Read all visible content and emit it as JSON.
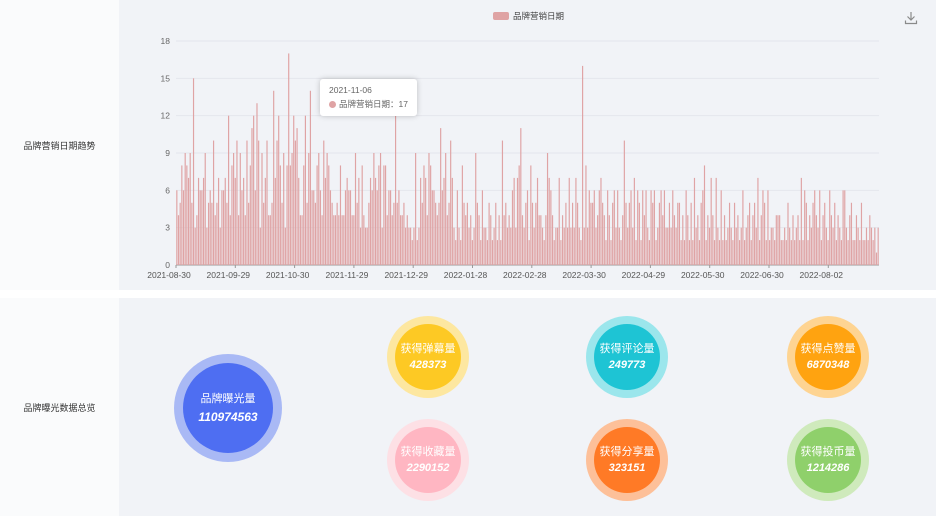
{
  "sections": {
    "trend_label": "品牌营销日期趋势",
    "summary_label": "品牌曝光数据总览"
  },
  "tooltip": {
    "date": "2021-11-06",
    "series": "品牌营销日期",
    "value_text": "17"
  },
  "toolbar": {
    "download_icon": "download-icon"
  },
  "stats": {
    "main": {
      "label": "品牌曝光量",
      "value": "110974563",
      "color": "#4e6ef2",
      "ring": "#a9b9f5"
    },
    "danmaku": {
      "label": "获得弹幕量",
      "value": "428373",
      "color": "#fdc924",
      "ring": "#fde7a0"
    },
    "comments": {
      "label": "获得评论量",
      "value": "249773",
      "color": "#1ec4d4",
      "ring": "#9be6ec"
    },
    "likes": {
      "label": "获得点赞量",
      "value": "6870348",
      "color": "#ffa310",
      "ring": "#fed492"
    },
    "favorites": {
      "label": "获得收藏量",
      "value": "2290152",
      "color": "#ffb6c2",
      "ring": "#fde0e5"
    },
    "shares": {
      "label": "获得分享量",
      "value": "323151",
      "color": "#ff7a26",
      "ring": "#fdc099"
    },
    "coins": {
      "label": "获得投币量",
      "value": "1214286",
      "color": "#8fd06b",
      "ring": "#cfeabc"
    }
  },
  "chart_data": {
    "type": "bar",
    "legend": {
      "name": "品牌营销日期",
      "position": "top-center"
    },
    "bar_color": "#dfa3a4",
    "ylim": [
      0,
      18
    ],
    "y_ticks": [
      "0",
      "3",
      "6",
      "9",
      "12",
      "15",
      "18"
    ],
    "x_tick_labels": [
      "2021-08-30",
      "2021-09-29",
      "2021-10-30",
      "2021-11-29",
      "2021-12-29",
      "2022-01-28",
      "2022-02-28",
      "2022-03-30",
      "2022-04-29",
      "2022-05-30",
      "2022-06-30",
      "2022-08-02"
    ],
    "grid": true,
    "series": [
      {
        "values": [
          6,
          4,
          5,
          8,
          6,
          9,
          8,
          7,
          9,
          5,
          15,
          3,
          4,
          7,
          6,
          6,
          7,
          9,
          3,
          5,
          6,
          5,
          10,
          4,
          5,
          7,
          3,
          6,
          6,
          7,
          5,
          12,
          4,
          8,
          9,
          7,
          10,
          4,
          9,
          6,
          7,
          4,
          10,
          5,
          8,
          11,
          12,
          6,
          13,
          10,
          3,
          9,
          5,
          7,
          10,
          4,
          4,
          5,
          14,
          7,
          10,
          12,
          8,
          5,
          9,
          3,
          8,
          17,
          8,
          9,
          12,
          10,
          11,
          7,
          4,
          4,
          8,
          12,
          5,
          9,
          14,
          6,
          6,
          5,
          8,
          9,
          6,
          4,
          10,
          7,
          9,
          8,
          6,
          5,
          4,
          4,
          5,
          4,
          8,
          4,
          4,
          6,
          7,
          6,
          6,
          4,
          4,
          9,
          5,
          7,
          3,
          8,
          4,
          3,
          3,
          5,
          7,
          6,
          9,
          7,
          6,
          8,
          9,
          3,
          8,
          8,
          4,
          6,
          6,
          4,
          5,
          12,
          5,
          6,
          4,
          4,
          5,
          3,
          4,
          3,
          3,
          2,
          3,
          9,
          2,
          3,
          7,
          5,
          8,
          7,
          4,
          9,
          8,
          6,
          6,
          5,
          4,
          5,
          11,
          6,
          7,
          9,
          4,
          5,
          10,
          7,
          3,
          2,
          6,
          3,
          2,
          8,
          5,
          4,
          5,
          3,
          4,
          2,
          3,
          9,
          5,
          4,
          2,
          6,
          3,
          3,
          2,
          5,
          4,
          2,
          3,
          5,
          2,
          4,
          2,
          10,
          4,
          5,
          3,
          4,
          3,
          6,
          7,
          3,
          7,
          8,
          11,
          4,
          3,
          5,
          6,
          2,
          8,
          5,
          3,
          5,
          7,
          4,
          4,
          3,
          2,
          4,
          9,
          7,
          6,
          4,
          2,
          3,
          3,
          7,
          2,
          4,
          3,
          5,
          3,
          7,
          3,
          5,
          3,
          7,
          5,
          3,
          2,
          16,
          3,
          8,
          3,
          6,
          5,
          5,
          6,
          3,
          4,
          6,
          7,
          5,
          4,
          2,
          6,
          4,
          2,
          5,
          6,
          3,
          6,
          3,
          2,
          4,
          10,
          5,
          3,
          5,
          6,
          3,
          7,
          2,
          6,
          5,
          2,
          6,
          4,
          6,
          3,
          2,
          6,
          5,
          6,
          2,
          3,
          5,
          6,
          4,
          6,
          3,
          3,
          5,
          3,
          6,
          4,
          3,
          5,
          5,
          2,
          4,
          2,
          6,
          4,
          2,
          5,
          2,
          7,
          3,
          4,
          2,
          5,
          6,
          8,
          2,
          4,
          3,
          7,
          4,
          2,
          7,
          3,
          2,
          6,
          2,
          4,
          2,
          3,
          5,
          3,
          2,
          5,
          3,
          4,
          2,
          3,
          6,
          2,
          3,
          4,
          5,
          2,
          4,
          5,
          3,
          7,
          2,
          4,
          6,
          5,
          2,
          6,
          2,
          3,
          3,
          2,
          4,
          4,
          4,
          2,
          2,
          3,
          2,
          5,
          3,
          2,
          4,
          2,
          3,
          4,
          2,
          7,
          2,
          6,
          5,
          2,
          4,
          3,
          5,
          6,
          4,
          3,
          6,
          2,
          4,
          5,
          3,
          2,
          6,
          4,
          3,
          5,
          2,
          4,
          3,
          2,
          6,
          6,
          3,
          2,
          4,
          5,
          2,
          2,
          4,
          3,
          2,
          5,
          2,
          2,
          3,
          2,
          4,
          3,
          2,
          3,
          1,
          3
        ]
      }
    ]
  }
}
